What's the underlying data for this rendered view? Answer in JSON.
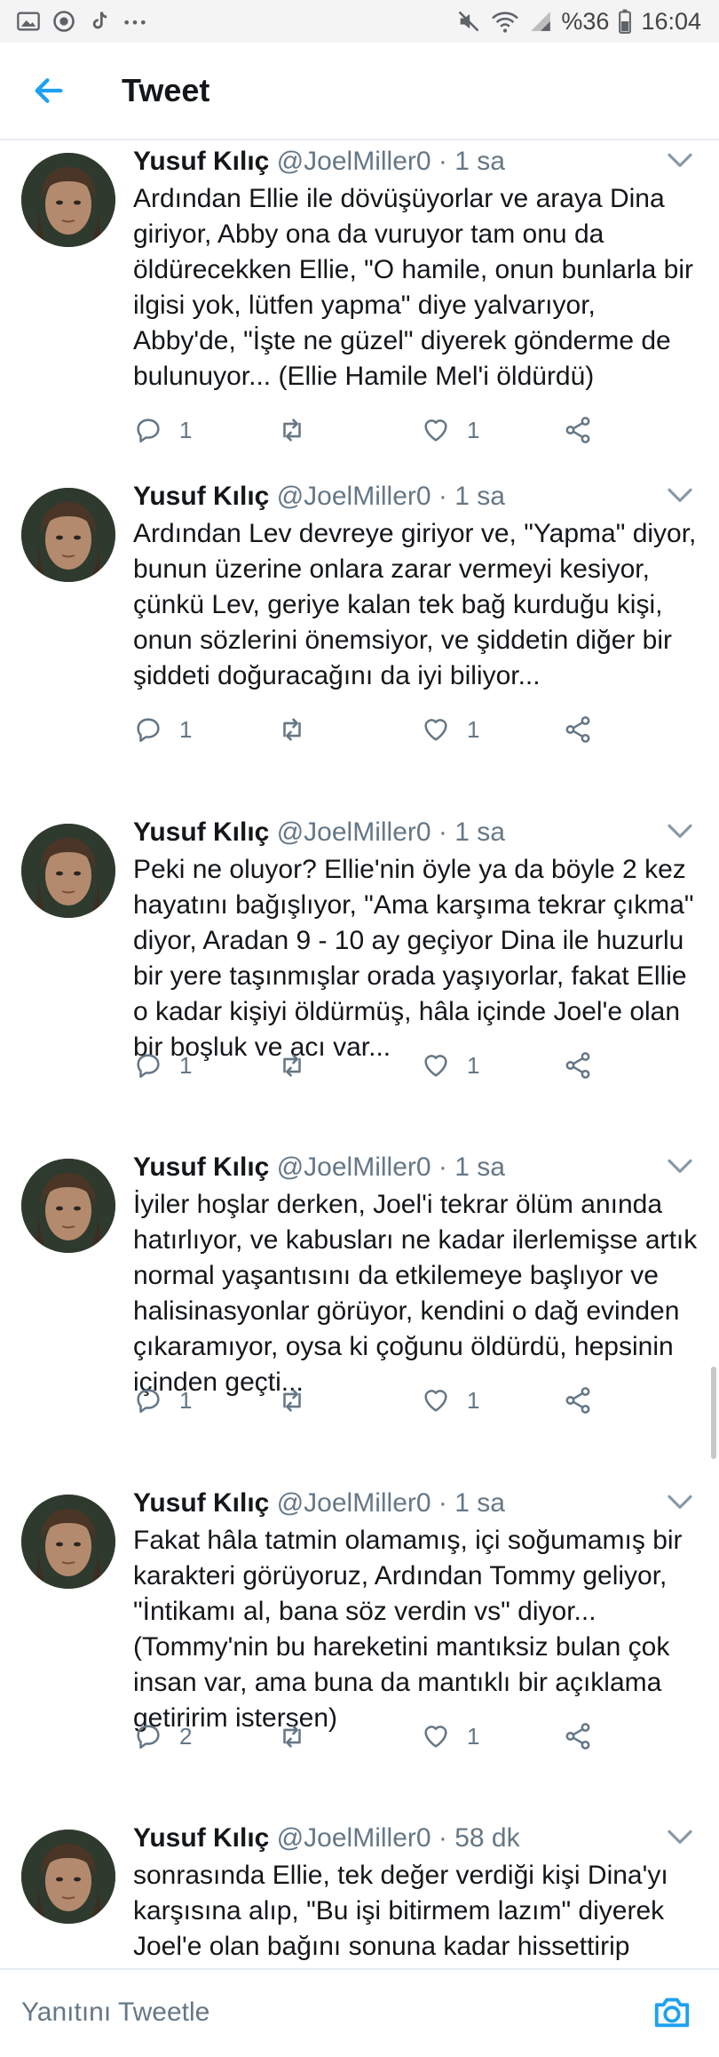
{
  "status_bar": {
    "battery": "%36",
    "time": "16:04",
    "left_icons": [
      "gallery-icon",
      "settings-icon",
      "tiktok-icon",
      "more-dots-icon"
    ],
    "right_icons": [
      "mute-icon",
      "wifi-icon",
      "signal-icon",
      "battery-icon"
    ]
  },
  "app_bar": {
    "title": "Tweet",
    "back_icon": "back-arrow-icon"
  },
  "colors": {
    "accent": "#1da1f2",
    "text": "#14171a",
    "secondary": "#657786",
    "divider": "#e6ecf0"
  },
  "tweets": [
    {
      "name": "Yusuf Kılıç",
      "handle": "@JoelMiller0",
      "time": "· 1 sa",
      "text": "Ardından Ellie ile dövüşüyorlar ve araya Dina giriyor, Abby ona da vuruyor tam onu da öldürecekken Ellie, \"O hamile, onun bunlarla bir ilgisi yok, lütfen yapma\" diye yalvarıyor, Abby'de, \"İşte ne güzel\" diyerek gönderme de bulunuyor... (Ellie Hamile Mel'i öldürdü)",
      "replies": "1",
      "likes": "1"
    },
    {
      "name": "Yusuf Kılıç",
      "handle": "@JoelMiller0",
      "time": "· 1 sa",
      "text": "Ardından Lev devreye giriyor ve, \"Yapma\" diyor, bunun üzerine onlara zarar vermeyi kesiyor, çünkü Lev, geriye kalan tek bağ kurduğu kişi, onun sözlerini önemsiyor, ve şiddetin diğer bir şiddeti doğuracağını da iyi biliyor...",
      "replies": "1",
      "likes": "1"
    },
    {
      "name": "Yusuf Kılıç",
      "handle": "@JoelMiller0",
      "time": "· 1 sa",
      "text": "Peki ne oluyor? Ellie'nin öyle ya da böyle 2 kez hayatını bağışlıyor, \"Ama karşıma tekrar çıkma\" diyor, Aradan 9 - 10 ay geçiyor Dina ile huzurlu bir yere taşınmışlar orada yaşıyorlar, fakat Ellie o kadar kişiyi öldürmüş, hâla içinde Joel'e olan bir boşluk ve acı var...",
      "replies": "1",
      "likes": "1"
    },
    {
      "name": "Yusuf Kılıç",
      "handle": "@JoelMiller0",
      "time": "· 1 sa",
      "text": "İyiler hoşlar derken, Joel'i tekrar ölüm anında hatırlıyor, ve kabusları ne kadar ilerlemişse artık normal yaşantısını da etkilemeye başlıyor ve halisinasyonlar görüyor, kendini o dağ evinden çıkaramıyor, oysa ki çoğunu öldürdü, hepsinin içinden geçti...",
      "replies": "1",
      "likes": "1"
    },
    {
      "name": "Yusuf Kılıç",
      "handle": "@JoelMiller0",
      "time": "· 1 sa",
      "text": "Fakat hâla tatmin olamamış, içi soğumamış bir karakteri görüyoruz, Ardından Tommy geliyor, \"İntikamı al, bana söz verdin vs\" diyor... (Tommy'nin bu hareketini mantıksiz bulan çok insan var, ama buna da mantıklı bir açıklama getiririm istersen)",
      "replies": "2",
      "likes": "1"
    },
    {
      "name": "Yusuf Kılıç",
      "handle": "@JoelMiller0",
      "time": "· 58 dk",
      "text": "sonrasında Ellie, tek değer verdiği kişi Dina'yı karşısına alıp, \"Bu işi bitirmem lazım\" diyerek Joel'e olan bağını sonuna kadar hissettirip",
      "replies": "",
      "likes": ""
    }
  ],
  "reply_bar": {
    "placeholder": "Yanıtını Tweetle",
    "camera_icon": "camera-icon"
  }
}
